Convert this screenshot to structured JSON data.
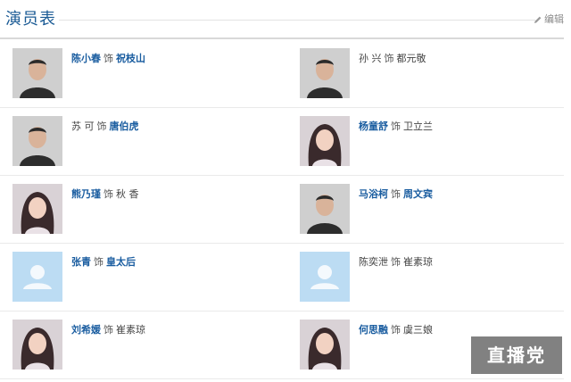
{
  "header": {
    "title": "演员表",
    "edit_label": "编辑",
    "accent_color": "#1b5b95"
  },
  "link_color": "#1a5da0",
  "cast": [
    {
      "actor": "陈小春",
      "connector": "饰",
      "role": "祝枝山",
      "actor_link": true,
      "role_link": true,
      "photo": "male-actor-photo"
    },
    {
      "actor": "孙 兴",
      "connector": "饰",
      "role": "都元敬",
      "actor_link": false,
      "role_link": false,
      "photo": "male-actor-photo"
    },
    {
      "actor": "苏 可",
      "connector": "饰",
      "role": "唐伯虎",
      "actor_link": false,
      "role_link": true,
      "photo": "male-actor-photo"
    },
    {
      "actor": "杨童舒",
      "connector": "饰",
      "role": "卫立兰",
      "actor_link": true,
      "role_link": false,
      "photo": "female-actor-photo"
    },
    {
      "actor": "熊乃瑾",
      "connector": "饰",
      "role": "秋 香",
      "actor_link": true,
      "role_link": false,
      "photo": "female-actor-photo"
    },
    {
      "actor": "马浴柯",
      "connector": "饰",
      "role": "周文宾",
      "actor_link": true,
      "role_link": true,
      "photo": "male-actor-photo"
    },
    {
      "actor": "张青",
      "connector": "饰",
      "role": "皇太后",
      "actor_link": true,
      "role_link": true,
      "photo": "default-avatar-icon"
    },
    {
      "actor": "陈奕泄",
      "connector": "饰",
      "role": "崔素琼",
      "actor_link": false,
      "role_link": false,
      "photo": "default-avatar-icon"
    },
    {
      "actor": "刘希媛",
      "connector": "饰",
      "role": "崔素琼",
      "actor_link": true,
      "role_link": false,
      "photo": "female-actor-photo"
    },
    {
      "actor": "何思融",
      "connector": "饰",
      "role": "虞三娘",
      "actor_link": true,
      "role_link": false,
      "photo": "female-actor-photo"
    }
  ],
  "watermark": "直播党"
}
